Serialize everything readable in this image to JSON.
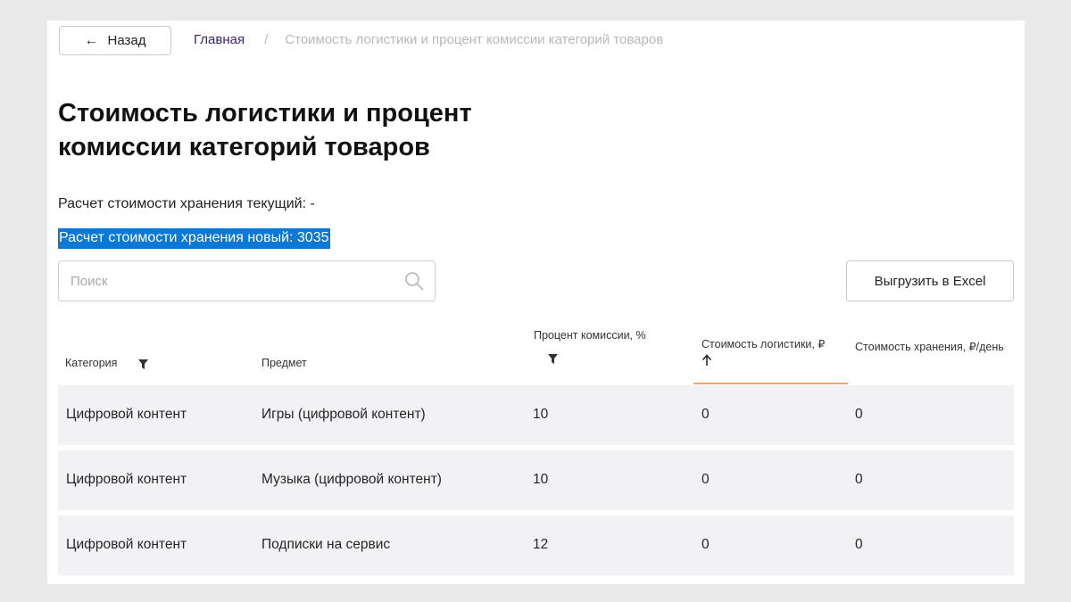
{
  "header": {
    "back_label": "Назад",
    "breadcrumb": {
      "home": "Главная",
      "separator": "/",
      "current": "Стоимость логистики и процент комиссии категорий товаров"
    }
  },
  "page": {
    "title": "Стоимость логистики и процент комиссии категорий товаров",
    "storage_current": "Расчет стоимости хранения текущий: -",
    "storage_new": "Расчет стоимости хранения новый: 3035"
  },
  "search": {
    "placeholder": "Поиск",
    "value": ""
  },
  "export_label": "Выгрузить в Excel",
  "table": {
    "columns": {
      "category": "Категория",
      "subject": "Предмет",
      "commission": "Процент комиссии, %",
      "logistics": "Стоимость логистики, ₽",
      "storage": "Стоимость хранения, ₽/день"
    },
    "rows": [
      {
        "category": "Цифровой контент",
        "subject": "Игры (цифровой контент)",
        "commission": "10",
        "logistics": "0",
        "storage": "0"
      },
      {
        "category": "Цифровой контент",
        "subject": "Музыка (цифровой контент)",
        "commission": "10",
        "logistics": "0",
        "storage": "0"
      },
      {
        "category": "Цифровой контент",
        "subject": "Подписки на сервис",
        "commission": "12",
        "logistics": "0",
        "storage": "0"
      }
    ]
  },
  "colors": {
    "accent_underline": "#f5a26b",
    "selection_highlight": "#0a78d7",
    "breadcrumb_link": "#3b1f6e",
    "row_background": "#f2f2f4"
  },
  "icons": {
    "back": "arrow-left-icon",
    "search": "search-icon",
    "filter": "filter-icon",
    "sort": "arrow-up-icon"
  }
}
